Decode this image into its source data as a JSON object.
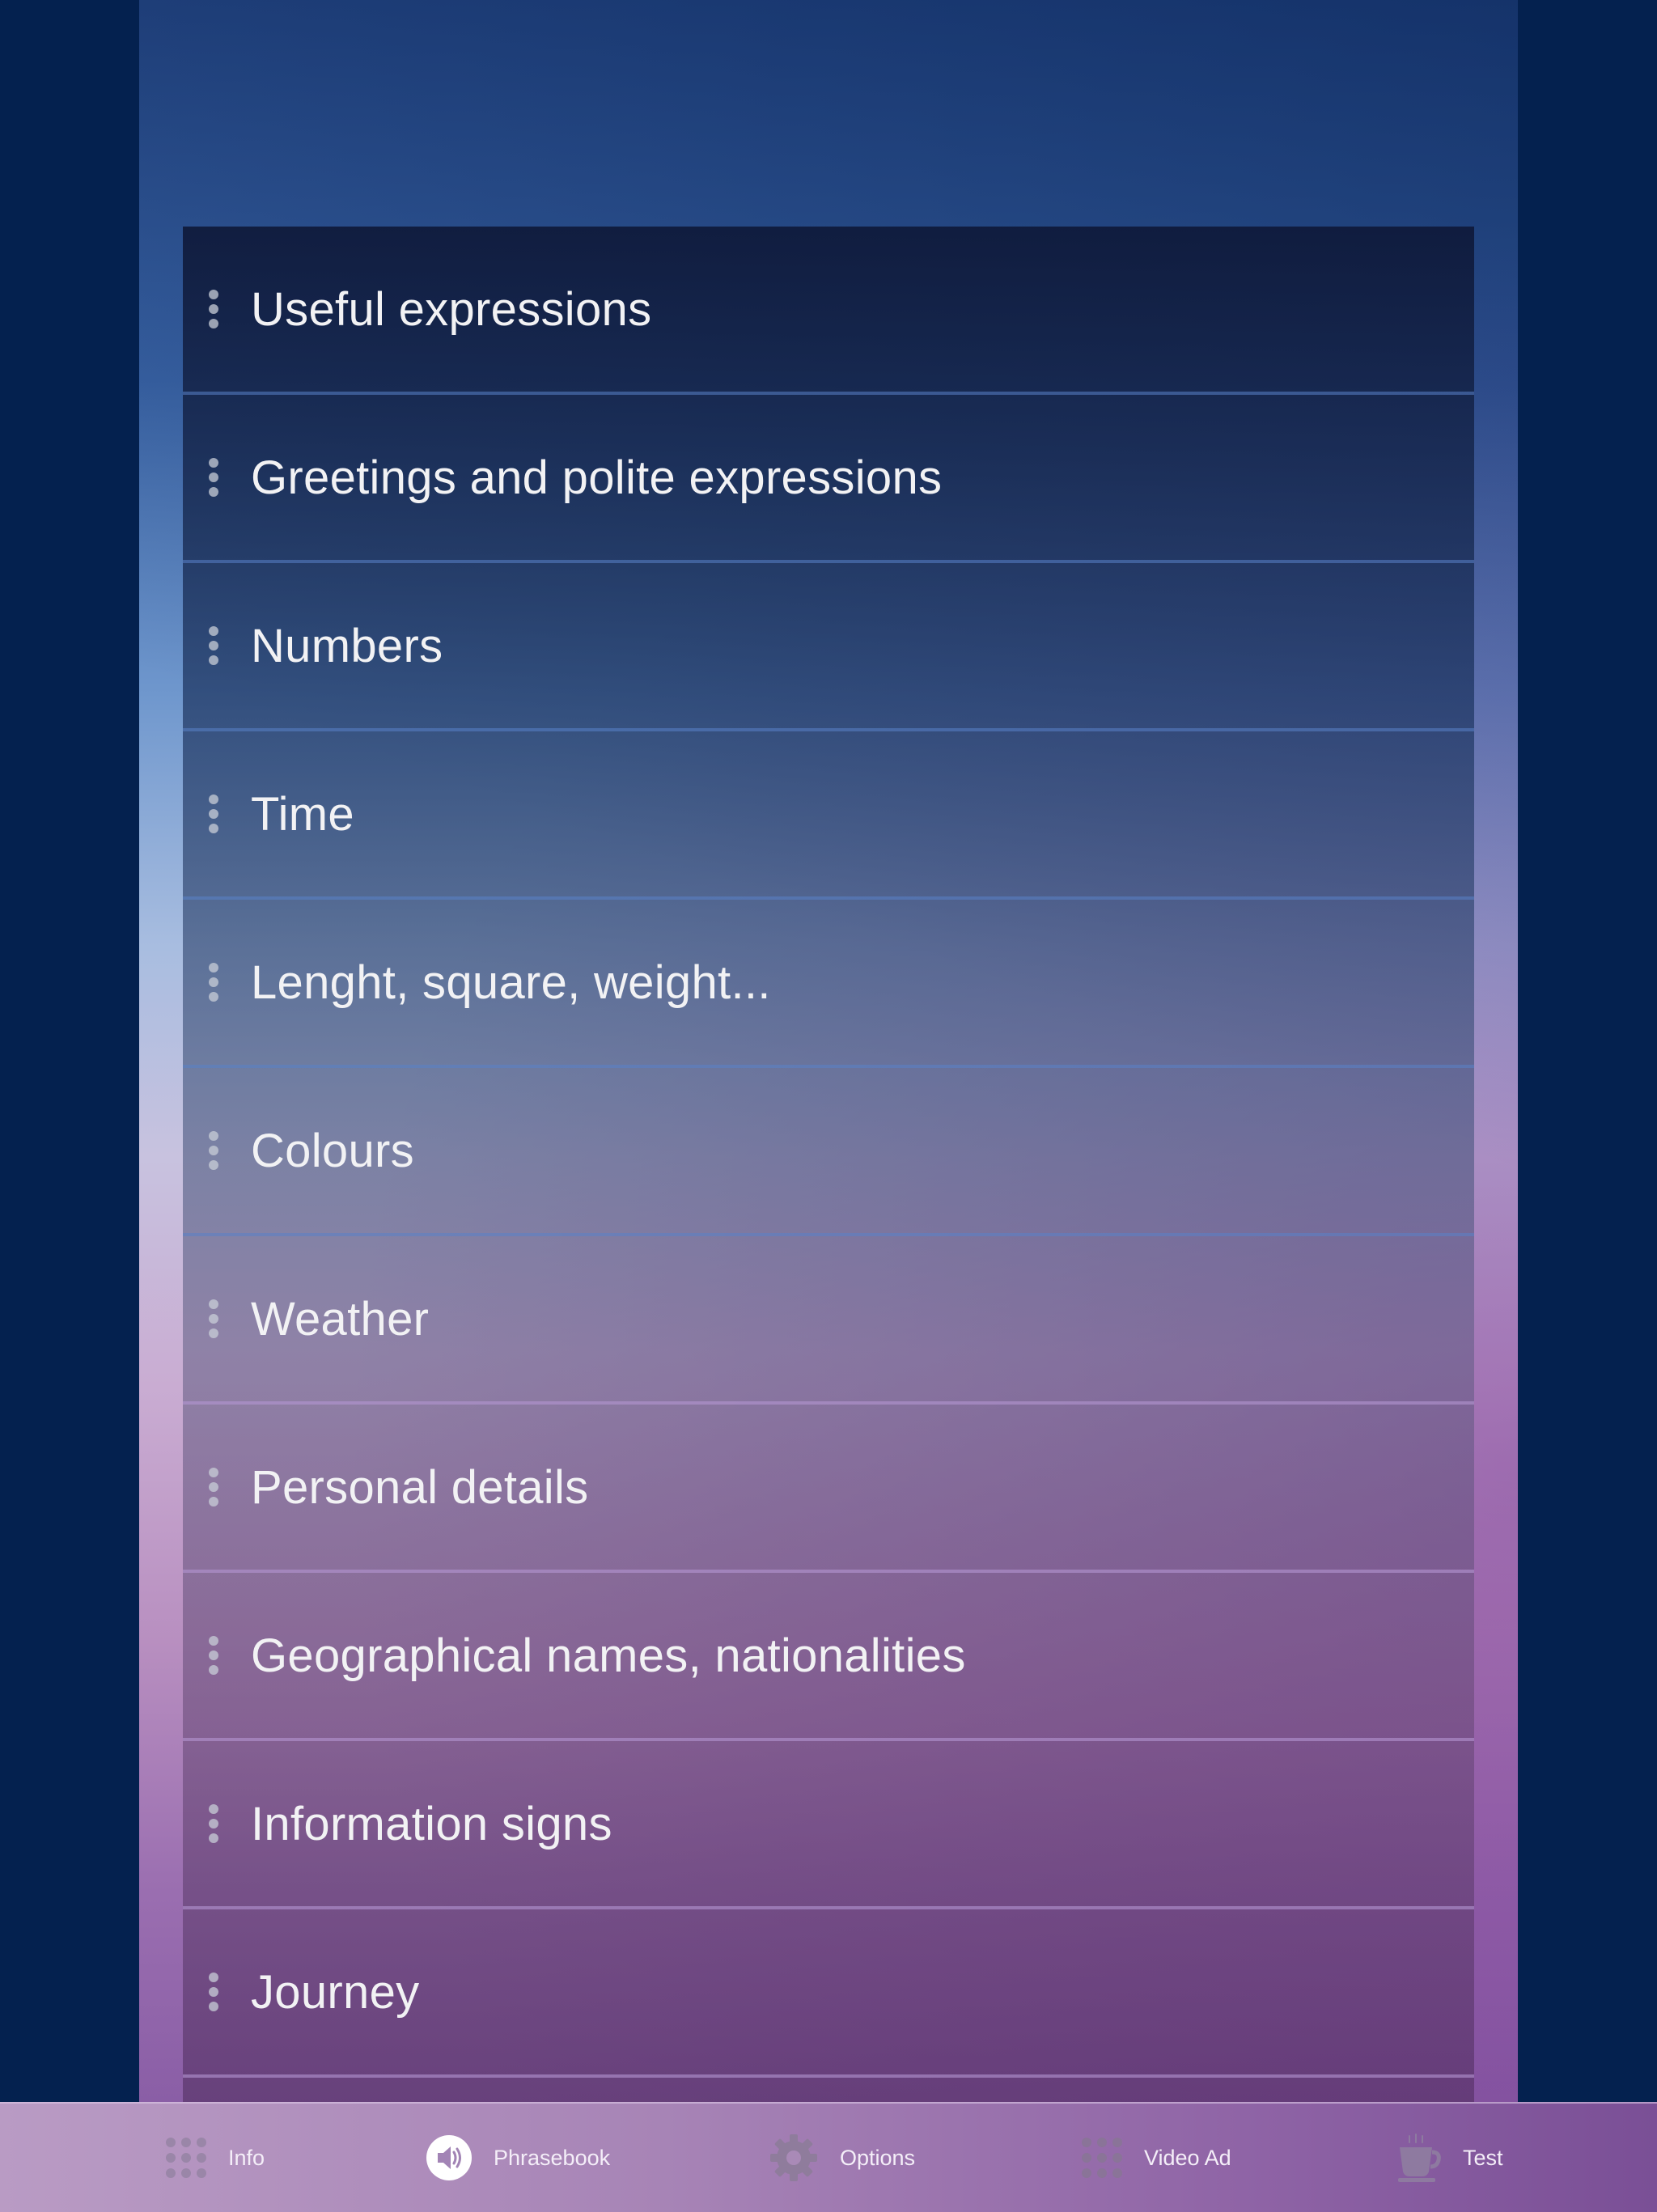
{
  "categories": [
    {
      "label": "Useful expressions"
    },
    {
      "label": "Greetings and polite expressions"
    },
    {
      "label": "Numbers"
    },
    {
      "label": "Time"
    },
    {
      "label": "Lenght, square, weight..."
    },
    {
      "label": "Colours"
    },
    {
      "label": "Weather"
    },
    {
      "label": "Personal details"
    },
    {
      "label": "Geographical names, nationalities"
    },
    {
      "label": "Information signs"
    },
    {
      "label": "Journey"
    }
  ],
  "tabbar": {
    "tabs": [
      {
        "label": "Info",
        "icon": "grid-icon"
      },
      {
        "label": "Phrasebook",
        "icon": "speaker-icon",
        "active": true
      },
      {
        "label": "Options",
        "icon": "gear-icon"
      },
      {
        "label": "Video Ad",
        "icon": "grid-icon"
      },
      {
        "label": "Test",
        "icon": "coffee-cup-icon"
      }
    ]
  }
}
